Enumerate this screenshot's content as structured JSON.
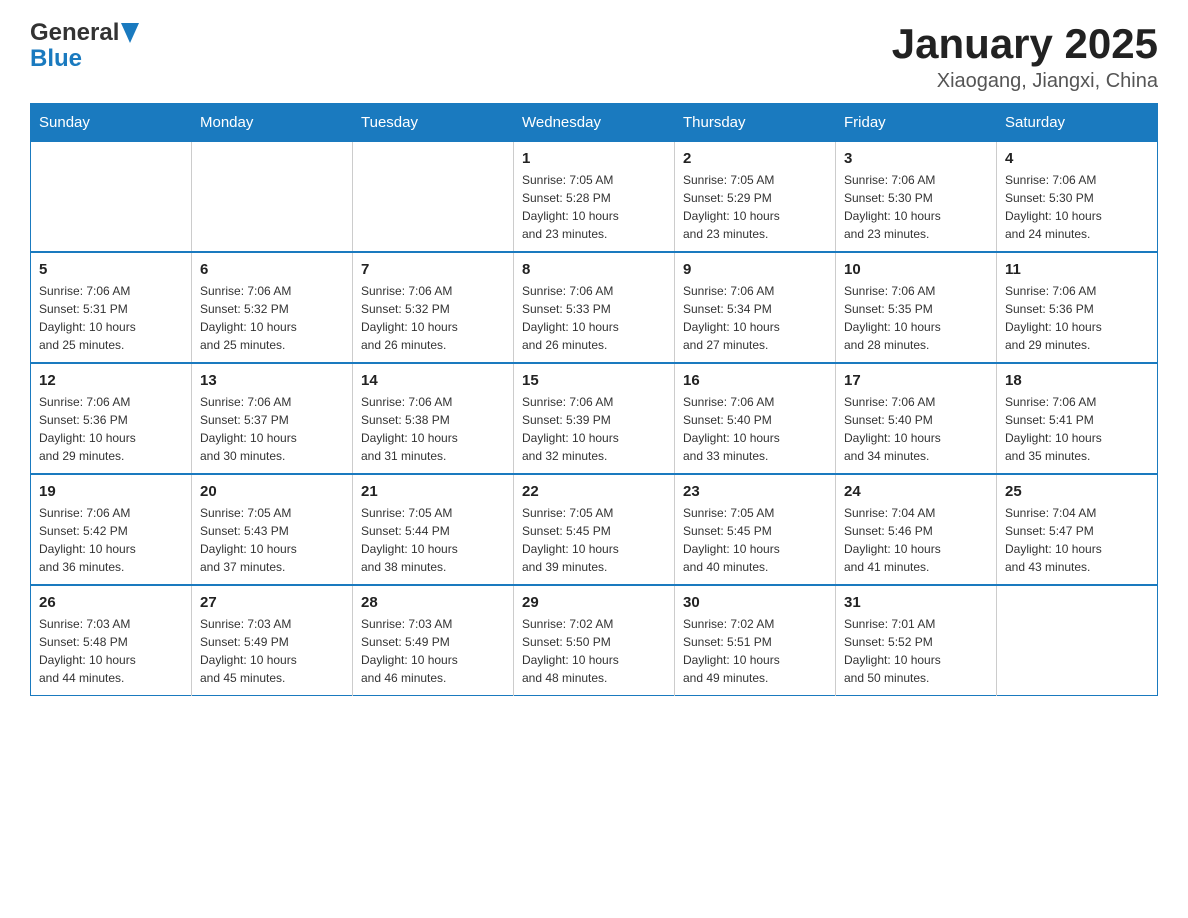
{
  "header": {
    "logo": {
      "text_general": "General",
      "text_blue": "Blue"
    },
    "title": "January 2025",
    "subtitle": "Xiaogang, Jiangxi, China"
  },
  "weekdays": [
    "Sunday",
    "Monday",
    "Tuesday",
    "Wednesday",
    "Thursday",
    "Friday",
    "Saturday"
  ],
  "weeks": [
    [
      {
        "day": "",
        "info": ""
      },
      {
        "day": "",
        "info": ""
      },
      {
        "day": "",
        "info": ""
      },
      {
        "day": "1",
        "info": "Sunrise: 7:05 AM\nSunset: 5:28 PM\nDaylight: 10 hours\nand 23 minutes."
      },
      {
        "day": "2",
        "info": "Sunrise: 7:05 AM\nSunset: 5:29 PM\nDaylight: 10 hours\nand 23 minutes."
      },
      {
        "day": "3",
        "info": "Sunrise: 7:06 AM\nSunset: 5:30 PM\nDaylight: 10 hours\nand 23 minutes."
      },
      {
        "day": "4",
        "info": "Sunrise: 7:06 AM\nSunset: 5:30 PM\nDaylight: 10 hours\nand 24 minutes."
      }
    ],
    [
      {
        "day": "5",
        "info": "Sunrise: 7:06 AM\nSunset: 5:31 PM\nDaylight: 10 hours\nand 25 minutes."
      },
      {
        "day": "6",
        "info": "Sunrise: 7:06 AM\nSunset: 5:32 PM\nDaylight: 10 hours\nand 25 minutes."
      },
      {
        "day": "7",
        "info": "Sunrise: 7:06 AM\nSunset: 5:32 PM\nDaylight: 10 hours\nand 26 minutes."
      },
      {
        "day": "8",
        "info": "Sunrise: 7:06 AM\nSunset: 5:33 PM\nDaylight: 10 hours\nand 26 minutes."
      },
      {
        "day": "9",
        "info": "Sunrise: 7:06 AM\nSunset: 5:34 PM\nDaylight: 10 hours\nand 27 minutes."
      },
      {
        "day": "10",
        "info": "Sunrise: 7:06 AM\nSunset: 5:35 PM\nDaylight: 10 hours\nand 28 minutes."
      },
      {
        "day": "11",
        "info": "Sunrise: 7:06 AM\nSunset: 5:36 PM\nDaylight: 10 hours\nand 29 minutes."
      }
    ],
    [
      {
        "day": "12",
        "info": "Sunrise: 7:06 AM\nSunset: 5:36 PM\nDaylight: 10 hours\nand 29 minutes."
      },
      {
        "day": "13",
        "info": "Sunrise: 7:06 AM\nSunset: 5:37 PM\nDaylight: 10 hours\nand 30 minutes."
      },
      {
        "day": "14",
        "info": "Sunrise: 7:06 AM\nSunset: 5:38 PM\nDaylight: 10 hours\nand 31 minutes."
      },
      {
        "day": "15",
        "info": "Sunrise: 7:06 AM\nSunset: 5:39 PM\nDaylight: 10 hours\nand 32 minutes."
      },
      {
        "day": "16",
        "info": "Sunrise: 7:06 AM\nSunset: 5:40 PM\nDaylight: 10 hours\nand 33 minutes."
      },
      {
        "day": "17",
        "info": "Sunrise: 7:06 AM\nSunset: 5:40 PM\nDaylight: 10 hours\nand 34 minutes."
      },
      {
        "day": "18",
        "info": "Sunrise: 7:06 AM\nSunset: 5:41 PM\nDaylight: 10 hours\nand 35 minutes."
      }
    ],
    [
      {
        "day": "19",
        "info": "Sunrise: 7:06 AM\nSunset: 5:42 PM\nDaylight: 10 hours\nand 36 minutes."
      },
      {
        "day": "20",
        "info": "Sunrise: 7:05 AM\nSunset: 5:43 PM\nDaylight: 10 hours\nand 37 minutes."
      },
      {
        "day": "21",
        "info": "Sunrise: 7:05 AM\nSunset: 5:44 PM\nDaylight: 10 hours\nand 38 minutes."
      },
      {
        "day": "22",
        "info": "Sunrise: 7:05 AM\nSunset: 5:45 PM\nDaylight: 10 hours\nand 39 minutes."
      },
      {
        "day": "23",
        "info": "Sunrise: 7:05 AM\nSunset: 5:45 PM\nDaylight: 10 hours\nand 40 minutes."
      },
      {
        "day": "24",
        "info": "Sunrise: 7:04 AM\nSunset: 5:46 PM\nDaylight: 10 hours\nand 41 minutes."
      },
      {
        "day": "25",
        "info": "Sunrise: 7:04 AM\nSunset: 5:47 PM\nDaylight: 10 hours\nand 43 minutes."
      }
    ],
    [
      {
        "day": "26",
        "info": "Sunrise: 7:03 AM\nSunset: 5:48 PM\nDaylight: 10 hours\nand 44 minutes."
      },
      {
        "day": "27",
        "info": "Sunrise: 7:03 AM\nSunset: 5:49 PM\nDaylight: 10 hours\nand 45 minutes."
      },
      {
        "day": "28",
        "info": "Sunrise: 7:03 AM\nSunset: 5:49 PM\nDaylight: 10 hours\nand 46 minutes."
      },
      {
        "day": "29",
        "info": "Sunrise: 7:02 AM\nSunset: 5:50 PM\nDaylight: 10 hours\nand 48 minutes."
      },
      {
        "day": "30",
        "info": "Sunrise: 7:02 AM\nSunset: 5:51 PM\nDaylight: 10 hours\nand 49 minutes."
      },
      {
        "day": "31",
        "info": "Sunrise: 7:01 AM\nSunset: 5:52 PM\nDaylight: 10 hours\nand 50 minutes."
      },
      {
        "day": "",
        "info": ""
      }
    ]
  ]
}
